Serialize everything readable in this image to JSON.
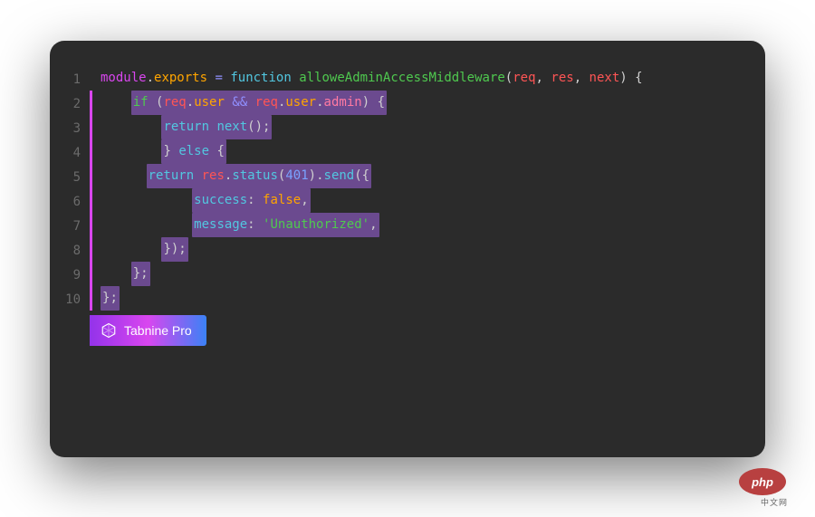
{
  "lines": [
    1,
    2,
    3,
    4,
    5,
    6,
    7,
    8,
    9,
    10
  ],
  "code": {
    "l1": {
      "module": "module",
      "dot1": ".",
      "exports": "exports",
      "sp1": " ",
      "eq": "=",
      "sp2": " ",
      "function": "function",
      "sp3": " ",
      "fname": "alloweAdminAccessMiddleware",
      "paren1": "(",
      "req": "req",
      "comma1": ", ",
      "res": "res",
      "comma2": ", ",
      "next": "next",
      "paren2": ")",
      "sp4": " ",
      "brace": "{"
    },
    "l2": {
      "if": "if",
      "sp1": " ",
      "p1": "(",
      "req": "req",
      "dot1": ".",
      "user": "user",
      "sp2": " ",
      "and": "&&",
      "sp3": " ",
      "req2": "req",
      "dot2": ".",
      "user2": "user",
      "dot3": ".",
      "admin": "admin",
      "p2": ")",
      "sp4": " ",
      "brace": "{"
    },
    "l3": {
      "return": "return",
      "sp1": " ",
      "next": "next",
      "parens": "()",
      "semi": ";"
    },
    "l4": {
      "brace": "}",
      "sp1": " ",
      "else": "else",
      "sp2": " ",
      "brace2": "{"
    },
    "l5": {
      "return": "return",
      "sp1": " ",
      "res": "res",
      "dot1": ".",
      "status": "status",
      "p1": "(",
      "num": "401",
      "p2": ")",
      "dot2": ".",
      "send": "send",
      "p3": "(",
      "brace": "{"
    },
    "l6": {
      "key": "success",
      "colon": ":",
      "sp1": " ",
      "val": "false",
      "comma": ","
    },
    "l7": {
      "key": "message",
      "colon": ":",
      "sp1": " ",
      "val": "'Unauthorized'",
      "comma": ","
    },
    "l8": {
      "brace": "})",
      "semi": ";"
    },
    "l9": {
      "brace": "}",
      "semi": ";"
    },
    "l10": {
      "brace": "}",
      "semi": ";"
    }
  },
  "badge": {
    "label": "Tabnine Pro"
  },
  "watermark": {
    "logo": "php",
    "tag": "中文网"
  }
}
